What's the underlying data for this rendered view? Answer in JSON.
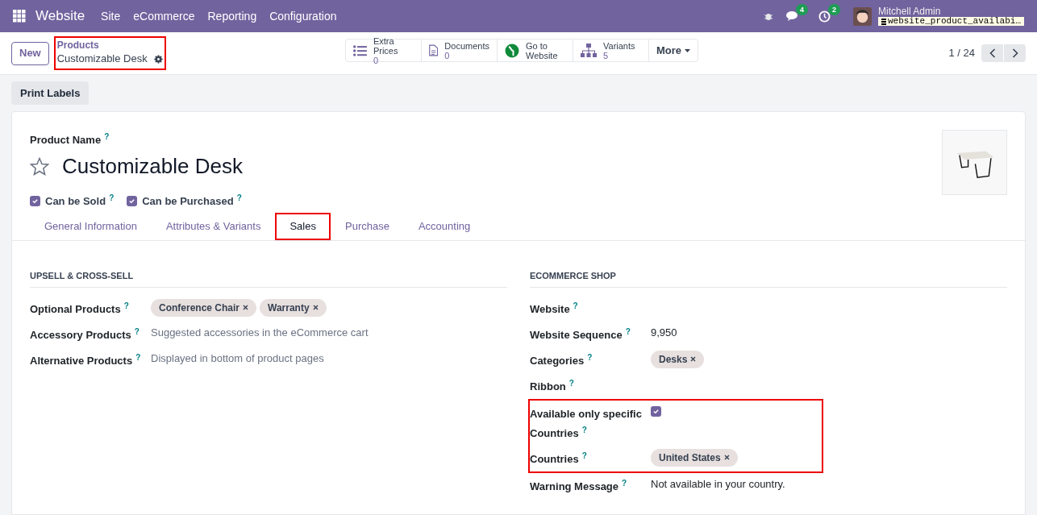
{
  "navbar": {
    "app": "Website",
    "menu": [
      "Site",
      "eCommerce",
      "Reporting",
      "Configuration"
    ],
    "messages_badge": "4",
    "activities_badge": "2",
    "user": "Mitchell Admin",
    "database": "website_product_availabi…"
  },
  "control_panel": {
    "new_button": "New",
    "breadcrumb": {
      "parent": "Products",
      "current": "Customizable Desk",
      "highlighted": true
    },
    "smart_buttons": [
      {
        "kind": "list",
        "label": "Extra Prices",
        "value": "0"
      },
      {
        "kind": "document",
        "label": "Documents",
        "value": "0"
      },
      {
        "kind": "globe",
        "label": "Go to",
        "value": "Website"
      },
      {
        "kind": "sitemap",
        "label": "Variants",
        "value": "5"
      }
    ],
    "more_button": "More",
    "pager": "1 / 24"
  },
  "action_button": "Print Labels",
  "form": {
    "name_label": "Product Name",
    "name_help": "?",
    "name": "Customizable Desk",
    "favorite": false,
    "checkboxes": [
      {
        "label": "Can be Sold",
        "help": "?",
        "checked": true
      },
      {
        "label": "Can be Purchased",
        "help": "?",
        "checked": true
      }
    ],
    "tabs": [
      {
        "label": "General Information",
        "selected": false,
        "highlighted": false
      },
      {
        "label": "Attributes & Variants",
        "selected": false,
        "highlighted": false
      },
      {
        "label": "Sales",
        "selected": true,
        "highlighted": true
      },
      {
        "label": "Purchase",
        "selected": false,
        "highlighted": false
      },
      {
        "label": "Accounting",
        "selected": false,
        "highlighted": false
      }
    ],
    "upsell": {
      "title": "UPSELL & CROSS-SELL",
      "fields": [
        {
          "kind": "tags",
          "label": "Optional Products",
          "help": "?",
          "tags": [
            "Conference Chair",
            "Warranty"
          ]
        },
        {
          "kind": "placeholder",
          "label": "Accessory Products",
          "help": "?",
          "placeholder": "Suggested accessories in the eCommerce cart"
        },
        {
          "kind": "placeholder",
          "label": "Alternative Products",
          "help": "?",
          "placeholder": "Displayed in bottom of product pages"
        }
      ]
    },
    "ecommerce": {
      "title": "ECOMMERCE SHOP",
      "fields": [
        {
          "kind": "value",
          "label": "Website",
          "help": "?"
        },
        {
          "kind": "value",
          "label": "Website Sequence",
          "help": "?",
          "value": "9,950"
        },
        {
          "kind": "tags",
          "label": "Categories",
          "help": "?",
          "tags": [
            "Desks"
          ]
        },
        {
          "kind": "value",
          "label": "Ribbon",
          "help": "?"
        },
        {
          "kind": "checkbox",
          "label": "Available only specific Countries",
          "help": "?",
          "checked": true,
          "highlighted": true
        },
        {
          "kind": "tags",
          "label": "Countries",
          "help": "?",
          "tags": [
            "United States"
          ],
          "highlighted": true
        },
        {
          "kind": "value",
          "label": "Warning Message",
          "help": "?",
          "value": "Not available in your country."
        }
      ]
    }
  }
}
